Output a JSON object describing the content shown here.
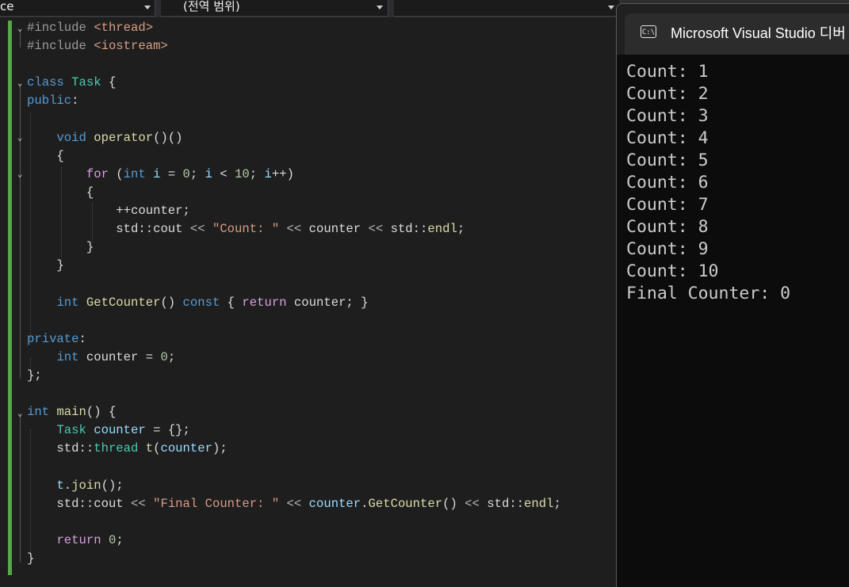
{
  "navbar": {
    "project_combo": "ce",
    "scope_combo": "(전역 범위)",
    "member_combo": ""
  },
  "editor": {
    "lines": [
      [
        [
          "pp",
          "#include "
        ],
        [
          "str",
          "<thread>"
        ]
      ],
      [
        [
          "pp",
          "#include "
        ],
        [
          "str",
          "<iostream>"
        ]
      ],
      [],
      [
        [
          "kw",
          "class "
        ],
        [
          "type",
          "Task"
        ],
        [
          "txt",
          " {"
        ]
      ],
      [
        [
          "kw",
          "public"
        ],
        [
          "txt",
          ":"
        ]
      ],
      [],
      [
        [
          "txt",
          "    "
        ],
        [
          "kw",
          "void "
        ],
        [
          "fn",
          "operator"
        ],
        [
          "txt",
          "()()"
        ]
      ],
      [
        [
          "txt",
          "    {"
        ]
      ],
      [
        [
          "txt",
          "        "
        ],
        [
          "ctl",
          "for"
        ],
        [
          "txt",
          " ("
        ],
        [
          "kw",
          "int "
        ],
        [
          "var",
          "i"
        ],
        [
          "txt",
          " = "
        ],
        [
          "num",
          "0"
        ],
        [
          "txt",
          "; "
        ],
        [
          "var",
          "i"
        ],
        [
          "txt",
          " < "
        ],
        [
          "num",
          "10"
        ],
        [
          "txt",
          "; "
        ],
        [
          "var",
          "i"
        ],
        [
          "txt",
          "++)"
        ]
      ],
      [
        [
          "txt",
          "        {"
        ]
      ],
      [
        [
          "txt",
          "            ++counter;"
        ]
      ],
      [
        [
          "txt",
          "            std::"
        ],
        [
          "txt",
          "cout"
        ],
        [
          "op",
          " << "
        ],
        [
          "str",
          "\"Count: \""
        ],
        [
          "op",
          " << "
        ],
        [
          "txt",
          "counter"
        ],
        [
          "op",
          " << "
        ],
        [
          "txt",
          "std::"
        ],
        [
          "fn",
          "endl"
        ],
        [
          "txt",
          ";"
        ]
      ],
      [
        [
          "txt",
          "        }"
        ]
      ],
      [
        [
          "txt",
          "    }"
        ]
      ],
      [],
      [
        [
          "txt",
          "    "
        ],
        [
          "kw",
          "int "
        ],
        [
          "fn",
          "GetCounter"
        ],
        [
          "txt",
          "() "
        ],
        [
          "kw",
          "const"
        ],
        [
          "txt",
          " { "
        ],
        [
          "ctl",
          "return"
        ],
        [
          "txt",
          " counter; }"
        ]
      ],
      [],
      [
        [
          "kw",
          "private"
        ],
        [
          "txt",
          ":"
        ]
      ],
      [
        [
          "txt",
          "    "
        ],
        [
          "kw",
          "int "
        ],
        [
          "txt",
          "counter = "
        ],
        [
          "num",
          "0"
        ],
        [
          "txt",
          ";"
        ]
      ],
      [
        [
          "txt",
          "};"
        ]
      ],
      [],
      [
        [
          "kw",
          "int "
        ],
        [
          "fn",
          "main"
        ],
        [
          "txt",
          "() {"
        ]
      ],
      [
        [
          "txt",
          "    "
        ],
        [
          "type",
          "Task "
        ],
        [
          "var",
          "counter"
        ],
        [
          "txt",
          " = {};"
        ]
      ],
      [
        [
          "txt",
          "    std::"
        ],
        [
          "type",
          "thread "
        ],
        [
          "fn",
          "t"
        ],
        [
          "txt",
          "("
        ],
        [
          "var",
          "counter"
        ],
        [
          "txt",
          ");"
        ]
      ],
      [],
      [
        [
          "txt",
          "    "
        ],
        [
          "var",
          "t"
        ],
        [
          "txt",
          "."
        ],
        [
          "fn",
          "join"
        ],
        [
          "txt",
          "();"
        ]
      ],
      [
        [
          "txt",
          "    std::"
        ],
        [
          "txt",
          "cout"
        ],
        [
          "op",
          " << "
        ],
        [
          "str",
          "\"Final Counter: \""
        ],
        [
          "op",
          " << "
        ],
        [
          "var",
          "counter"
        ],
        [
          "txt",
          "."
        ],
        [
          "fn",
          "GetCounter"
        ],
        [
          "txt",
          "()"
        ],
        [
          "op",
          " << "
        ],
        [
          "txt",
          "std::"
        ],
        [
          "fn",
          "endl"
        ],
        [
          "txt",
          ";"
        ]
      ],
      [],
      [
        [
          "txt",
          "    "
        ],
        [
          "ctl",
          "return"
        ],
        [
          "txt",
          " "
        ],
        [
          "num",
          "0"
        ],
        [
          "txt",
          ";"
        ]
      ],
      [
        [
          "txt",
          "}"
        ]
      ]
    ]
  },
  "console": {
    "title": "Microsoft Visual Studio 디버",
    "icon_text": "C:\\",
    "output": [
      "Count: 1",
      "Count: 2",
      "Count: 3",
      "Count: 4",
      "Count: 5",
      "Count: 6",
      "Count: 7",
      "Count: 8",
      "Count: 9",
      "Count: 10",
      "Final Counter: 0"
    ]
  },
  "colors": {
    "editor_bg": "#1e1e1e",
    "console_bg": "#0c0c0c",
    "change_bar": "#57a64a",
    "keyword": "#569cd6",
    "type": "#4ec9b0",
    "function": "#dcdcaa",
    "string": "#d69d85",
    "number": "#b5cea8",
    "control": "#d8a0df"
  }
}
